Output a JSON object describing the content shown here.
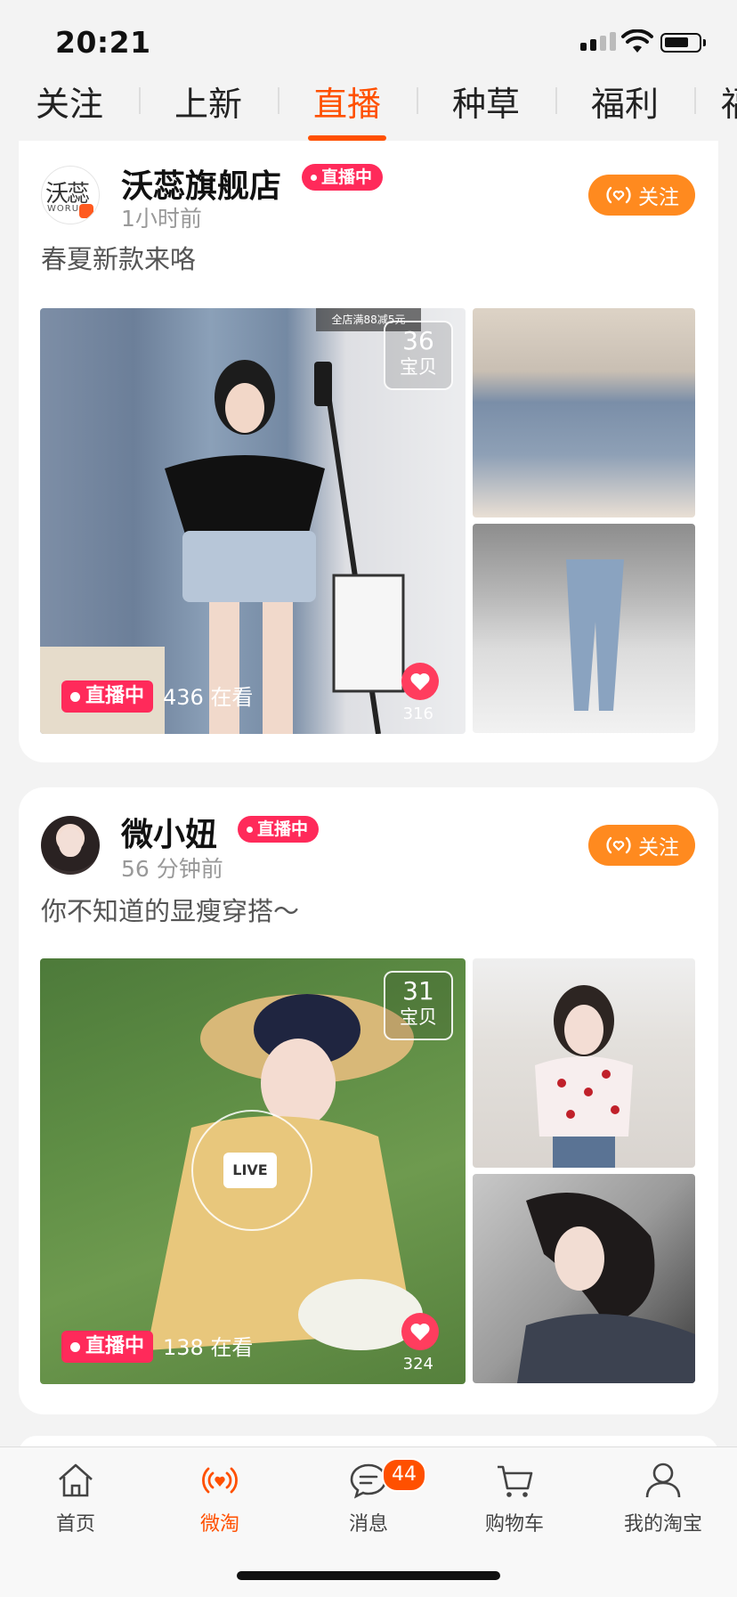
{
  "status_bar": {
    "time": "20:21"
  },
  "tabs": [
    "关注",
    "上新",
    "直播",
    "种草",
    "福利",
    "福"
  ],
  "active_tab": "直播",
  "feed": [
    {
      "shop": "沃蕊旗舰店",
      "avatar_text": "沃蕊",
      "avatar_sub": "WORU",
      "live_badge": "直播中",
      "time": "1小时前",
      "follow": "关注",
      "desc": "春夏新款来咯",
      "promo": "全店满88减5元",
      "item_count": "36",
      "item_unit": "宝贝",
      "live_chip": "直播中",
      "viewers": "436 在看",
      "likes": "316"
    },
    {
      "shop": "微小妞",
      "live_badge": "直播中",
      "time": "56 分钟前",
      "follow": "关注",
      "desc": "你不知道的显瘦穿搭～",
      "item_count": "31",
      "item_unit": "宝贝",
      "live_label": "LIVE",
      "live_chip": "直播中",
      "viewers": "138 在看",
      "likes": "324"
    }
  ],
  "bottom_nav": [
    {
      "label": "首页",
      "icon": "home-icon"
    },
    {
      "label": "微淘",
      "icon": "live-heart-icon",
      "active": true
    },
    {
      "label": "消息",
      "icon": "message-icon",
      "badge": "44"
    },
    {
      "label": "购物车",
      "icon": "cart-icon"
    },
    {
      "label": "我的淘宝",
      "icon": "profile-icon"
    }
  ],
  "colors": {
    "accent": "#ff5000",
    "live": "#ff2a5a",
    "follow": "#ff8a1f"
  }
}
